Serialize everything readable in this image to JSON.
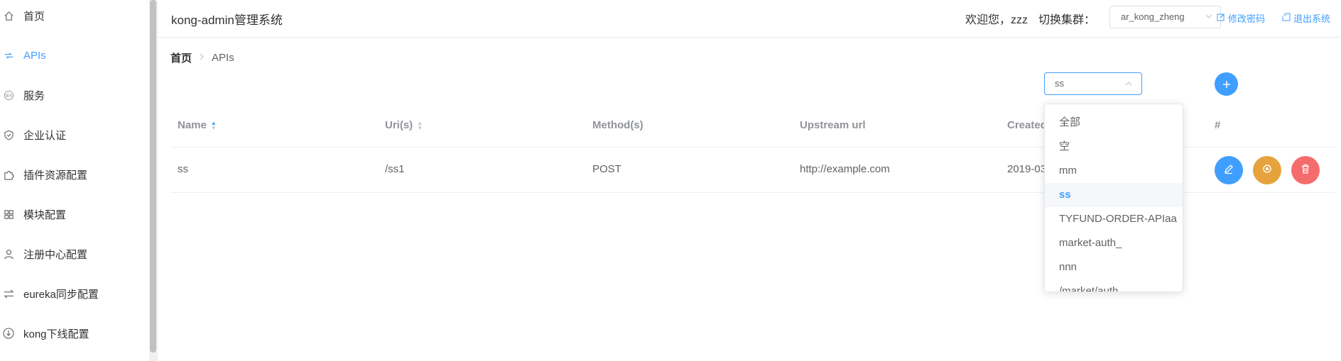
{
  "app": {
    "title": "kong-admin管理系统"
  },
  "header": {
    "welcome": "欢迎您，zzz",
    "cluster_label": "切换集群：",
    "cluster_value": "ar_kong_zheng",
    "change_password": "修改密码",
    "logout": "退出系统"
  },
  "sidebar": {
    "items": [
      {
        "label": "首页",
        "icon": "home-icon"
      },
      {
        "label": "APIs",
        "icon": "api-icon",
        "active": true
      },
      {
        "label": "服务",
        "icon": "service-icon"
      },
      {
        "label": "企业认证",
        "icon": "shield-icon"
      },
      {
        "label": "插件资源配置",
        "icon": "puzzle-icon"
      },
      {
        "label": "模块配置",
        "icon": "module-icon"
      },
      {
        "label": "注册中心配置",
        "icon": "user-icon"
      },
      {
        "label": "eureka同步配置",
        "icon": "sync-icon"
      },
      {
        "label": "kong下线配置",
        "icon": "download-icon"
      }
    ]
  },
  "breadcrumb": {
    "home": "首页",
    "current": "APIs"
  },
  "filter": {
    "value": "ss",
    "options": [
      "全部",
      "空",
      "mm",
      "ss",
      "TYFUND-ORDER-APIaa",
      "market-auth_",
      "nnn",
      "/market/auth"
    ],
    "selected_index": 3
  },
  "table": {
    "columns": [
      "Name",
      "Uri(s)",
      "Method(s)",
      "Upstream url",
      "Created",
      "#"
    ],
    "rows": [
      {
        "name": "ss",
        "uris": "/ss1",
        "methods": "POST",
        "upstream": "http://example.com",
        "created": "2019-03"
      }
    ]
  },
  "colors": {
    "primary": "#409eff",
    "warning": "#e6a23c",
    "danger": "#f56c6c"
  }
}
